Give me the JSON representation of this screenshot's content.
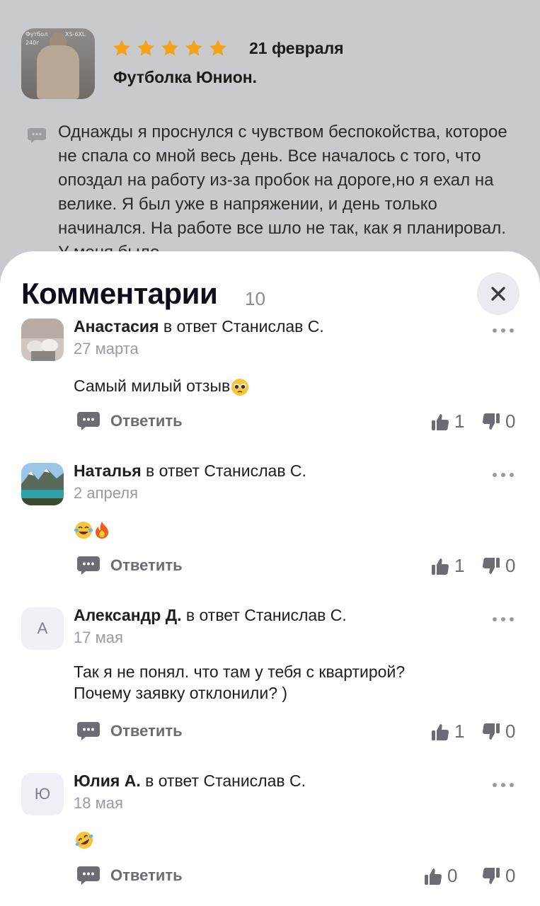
{
  "review": {
    "date": "21 февраля",
    "product": "Футболка Юнион.",
    "rating": 5,
    "thumb_tags": [
      "Футбол",
      "XS-6XL",
      "240г"
    ],
    "text": "Однажды я проснулся с чувством беспокойства, которое не спала со мной весь день. Все началось с того, что опоздал на работу из-за пробок на дороге,но я ехал на велике. Я был уже в напряжении, и день только начинался. На работе все шло не так, как я планировал. У меня было"
  },
  "sheet": {
    "title": "Комментарии",
    "count": "10"
  },
  "labels": {
    "in_reply_to": "в ответ",
    "reply": "Ответить"
  },
  "comments": [
    {
      "author": "Анастасия",
      "reply_to": "Станислав С.",
      "date": "27 марта",
      "text": "Самый милый отзыв",
      "emoji": [
        "pleading-face"
      ],
      "likes": "1",
      "dislikes": "0",
      "avatar": "photo"
    },
    {
      "author": "Наталья",
      "reply_to": "Станислав С.",
      "date": "2 апреля",
      "text": "",
      "emoji": [
        "tears-of-joy",
        "fire"
      ],
      "likes": "1",
      "dislikes": "0",
      "avatar": "lake-photo"
    },
    {
      "author": "Александр Д.",
      "reply_to": "Станислав С.",
      "date": "17 мая",
      "text_lines": [
        "Так я не понял. что там у тебя с квартирой?",
        "Почему заявку отклонили? )"
      ],
      "likes": "1",
      "dislikes": "0",
      "avatar_letter": "А"
    },
    {
      "author": "Юлия А.",
      "reply_to": "Станислав С.",
      "date": "18 мая",
      "text": "",
      "emoji": [
        "rolling-on-floor-laughing"
      ],
      "likes": "0",
      "dislikes": "0",
      "avatar_letter": "Ю"
    }
  ],
  "colors": {
    "star": "#f4a21a",
    "dim_background": "#c9cacd",
    "muted": "#6c6c75",
    "close_bg": "#eaeaf0"
  }
}
